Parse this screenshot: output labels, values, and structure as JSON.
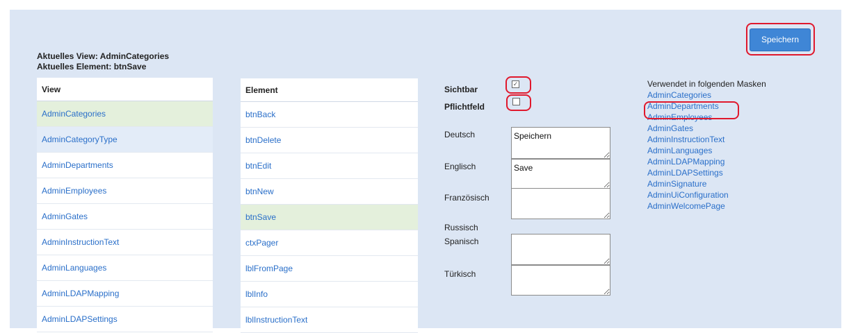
{
  "current": {
    "view_line": "Aktuelles View: AdminCategories",
    "element_line": "Aktuelles Element: btnSave"
  },
  "views": {
    "header": "View",
    "items": [
      "AdminCategories",
      "AdminCategoryType",
      "AdminDepartments",
      "AdminEmployees",
      "AdminGates",
      "AdminInstructionText",
      "AdminLanguages",
      "AdminLDAPMapping",
      "AdminLDAPSettings"
    ],
    "selected": "AdminCategories",
    "hovered": "AdminCategoryType"
  },
  "elements": {
    "header": "Element",
    "items": [
      "btnBack",
      "btnDelete",
      "btnEdit",
      "btnNew",
      "btnSave",
      "ctxPager",
      "lblFromPage",
      "lblInfo",
      "lblInstructionText"
    ],
    "selected": "btnSave"
  },
  "props": {
    "visible_label": "Sichtbar",
    "visible_checked": true,
    "required_label": "Pflichtfeld",
    "required_checked": false,
    "check_mark": "✓"
  },
  "translations": {
    "german_label": "Deutsch",
    "german_value": "Speichern",
    "english_label": "Englisch",
    "english_value": "Save",
    "french_label": "Französisch",
    "french_value": "",
    "russian_label": "Russisch",
    "russian_value": "",
    "spanish_label": "Spanisch",
    "spanish_value": "",
    "turkish_label": "Türkisch",
    "turkish_value": ""
  },
  "masks": {
    "title": "Verwendet in folgenden Masken",
    "items": [
      "AdminCategories",
      "AdminDepartments",
      "AdminEmployees",
      "AdminGates",
      "AdminInstructionText",
      "AdminLanguages",
      "AdminLDAPMapping",
      "AdminLDAPSettings",
      "AdminSignature",
      "AdminUiConfiguration",
      "AdminWelcomePage"
    ]
  },
  "save_button": "Speichern",
  "colors": {
    "panel_bg": "#dce6f4",
    "link": "#2a6fc9",
    "selected_row": "#e4f0dc",
    "button": "#3f86d6",
    "highlight_ring": "#e0182c"
  }
}
